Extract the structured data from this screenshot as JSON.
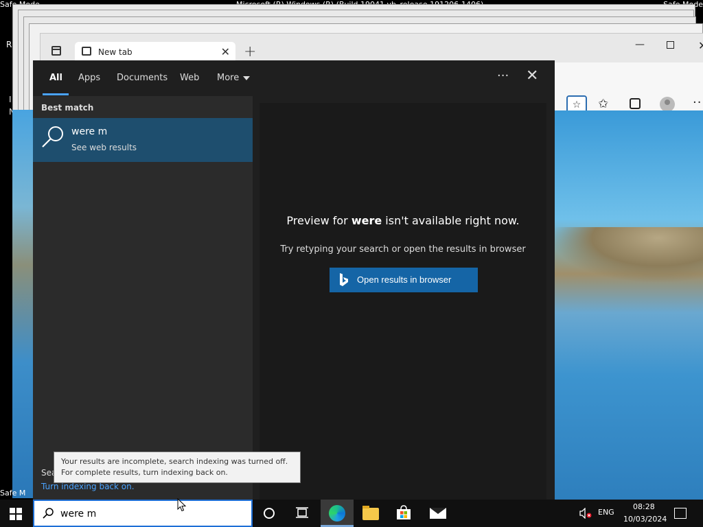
{
  "desktop": {
    "safe_mode_top_left": "Safe Mode",
    "safe_mode_top_right": "Safe Mode",
    "safe_mode_bottom_left": "Safe M",
    "build_info": "Microsoft (R) Windows (R) (Build 19041.vb_release.191206-1406)",
    "r_label": "R",
    "i_label": "I",
    "n_label": "N"
  },
  "browser": {
    "tab_title": "New tab",
    "tab_close": "✕",
    "new_tab": "+",
    "minimize": "—",
    "close": "✕",
    "favorite_add": "☆",
    "favorites_icon": "✩",
    "more": "···"
  },
  "search_panel": {
    "scopes": {
      "all": "All",
      "apps": "Apps",
      "documents": "Documents",
      "web": "Web",
      "more": "More"
    },
    "ellipsis": "···",
    "close": "✕",
    "best_match_heading": "Best match",
    "result": {
      "title": "were m",
      "subtitle": "See web results"
    },
    "search_label_partial": "Sea",
    "indexing_link": "Turn indexing back on.",
    "preview": {
      "prefix": "Preview for ",
      "term": "were",
      "suffix": " isn't available right now.",
      "sub": "Try retyping your search or open the results in browser",
      "button": "Open results in browser"
    }
  },
  "tooltip": "Your results are incomplete, search indexing was turned off. For complete results, turn indexing back on.",
  "taskbar": {
    "search_value": "were m",
    "language": "ENG",
    "time": "08:28",
    "date": "10/03/2024"
  },
  "colors": {
    "accent": "#1565a6",
    "selection": "#1e4e6e",
    "link": "#4aa3ff",
    "panel_bg": "#1f1f1f",
    "taskbar_bg": "#101010"
  },
  "icons": {
    "search": "search-icon",
    "bing": "bing-icon",
    "windows": "windows-logo-icon",
    "cortana": "cortana-icon",
    "task_view": "task-view-icon",
    "edge": "edge-icon",
    "file_explorer": "file-explorer-icon",
    "store": "store-icon",
    "mail": "mail-icon",
    "volume_muted": "volume-muted-icon",
    "notifications": "notification-icon"
  }
}
